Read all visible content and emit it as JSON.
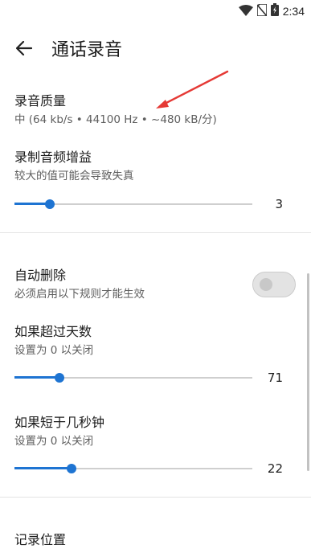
{
  "status": {
    "time": "2:34"
  },
  "header": {
    "title": "通话录音"
  },
  "quality": {
    "title": "录音质量",
    "summary": "中 (64 kb/s • 44100 Hz  • ~480 kB/分)"
  },
  "gain": {
    "title": "录制音频增益",
    "summary": "较大的值可能会导致失真",
    "value": "3",
    "fraction": 0.15
  },
  "auto_delete": {
    "title": "自动删除",
    "summary": "必须启用以下规则才能生效",
    "enabled": false
  },
  "days": {
    "title": "如果超过天数",
    "summary": "设置为 0 以关闭",
    "value": "71",
    "fraction": 0.19
  },
  "seconds": {
    "title": "如果短于几秒钟",
    "summary": "设置为 0 以关闭",
    "value": "22",
    "fraction": 0.24
  },
  "location": {
    "title": "记录位置"
  },
  "colors": {
    "accent": "#1e74d2",
    "annotation_arrow": "#e53935"
  }
}
